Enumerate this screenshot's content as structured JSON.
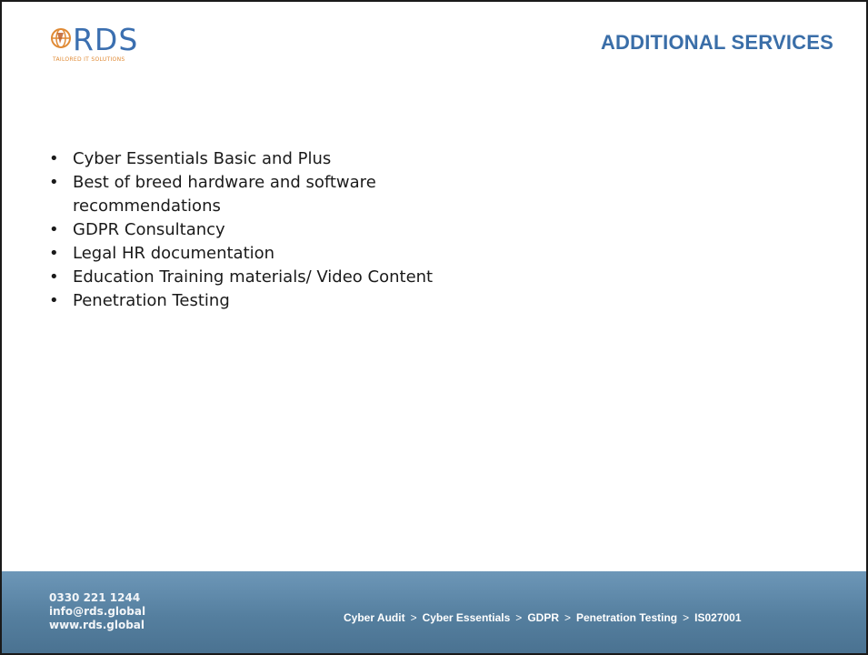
{
  "logo": {
    "text": "RDS",
    "tagline": "TAILORED IT SOLUTIONS",
    "colors": {
      "primary": "#3b6fb0",
      "accent": "#e08a34"
    }
  },
  "title": "ADDITIONAL SERVICES",
  "bullets": [
    "Cyber Essentials Basic and Plus",
    "Best of breed hardware and software recommendations",
    "GDPR Consultancy",
    "Legal HR documentation",
    "Education Training materials/ Video Content",
    "Penetration Testing"
  ],
  "footer": {
    "phone": "0330 221 1244",
    "email": "info@rds.global",
    "website": "www.rds.global",
    "nav": [
      "Cyber Audit",
      "Cyber Essentials",
      "GDPR",
      "Penetration Testing",
      "IS027001"
    ],
    "separator": ">",
    "background_color": "#557f9f"
  }
}
